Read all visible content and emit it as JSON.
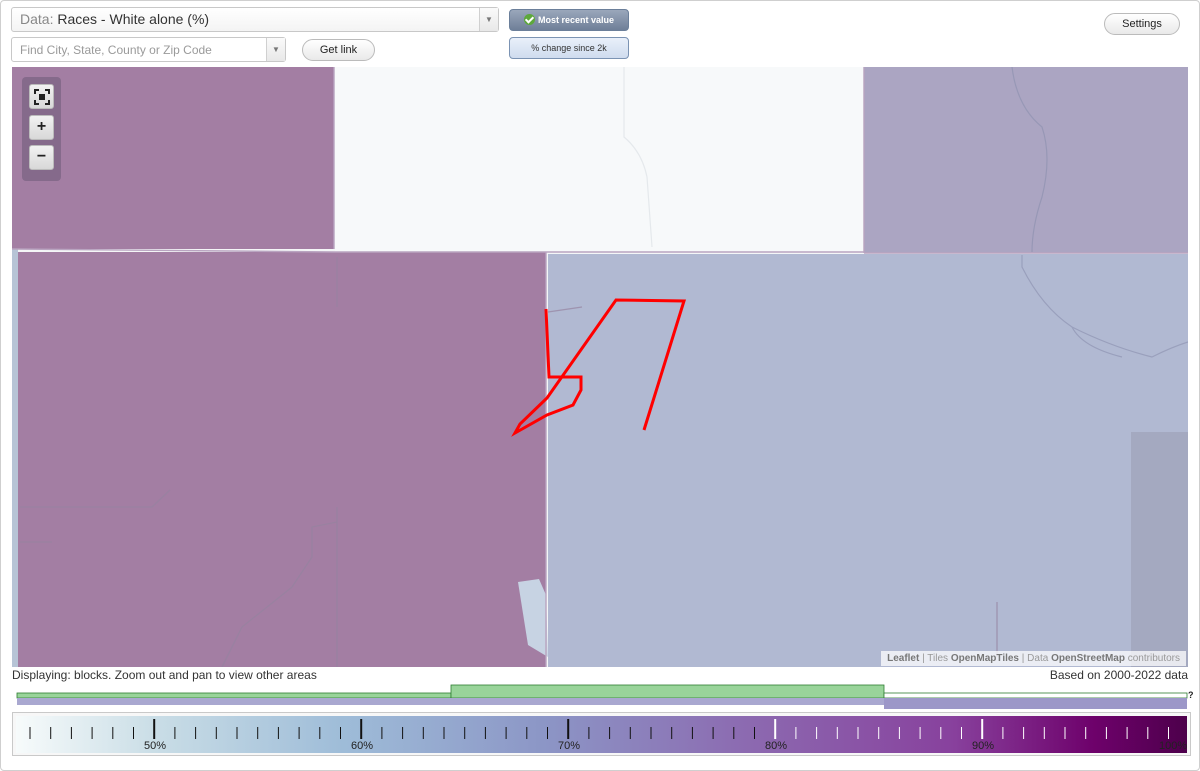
{
  "header": {
    "data_prefix": "Data:",
    "data_value": "Races - White alone (%)",
    "search_placeholder": "Find City, State, County or Zip Code",
    "get_link_label": "Get link",
    "most_recent_label": "Most recent value",
    "change_label": "% change since 2k",
    "settings_label": "Settings"
  },
  "map": {
    "zoom_in_label": "+",
    "zoom_out_label": "−",
    "fit_icon": "fullscreen-icon",
    "attribution": {
      "leaflet": "Leaflet",
      "tiles_prefix": "| Tiles",
      "tiles_source": "OpenMapTiles",
      "data_prefix": "| Data",
      "data_source": "OpenStreetMap",
      "data_suffix": "contributors"
    },
    "colors": {
      "high": "#a37ea3",
      "mid_high": "#aba5c2",
      "mid": "#b1b9d2",
      "low": "#f7f9fa",
      "selection": "#ff0000"
    }
  },
  "status": {
    "displaying": "Displaying: blocks. Zoom out and pan to view other areas",
    "based_on": "Based on 2000-2022 data",
    "help": "?"
  },
  "legend": {
    "labels": [
      "50%",
      "60%",
      "70%",
      "80%",
      "90%",
      "100%"
    ]
  }
}
